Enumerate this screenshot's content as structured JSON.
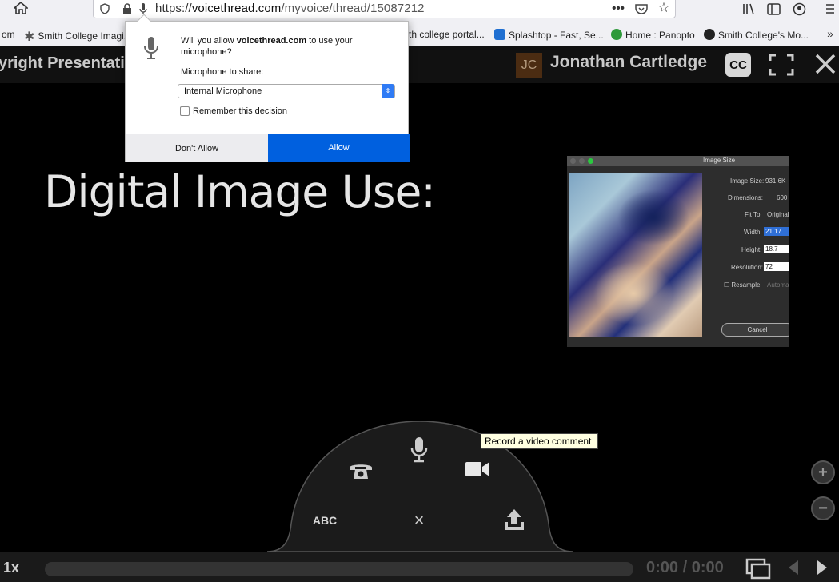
{
  "browser": {
    "url_scheme": "https://",
    "url_host": "voicethread.com",
    "url_path": "/myvoice/thread/15087212",
    "bookmarks": [
      {
        "label": "om",
        "icon": "none"
      },
      {
        "label": "Smith College Imagi...",
        "icon": "asterisk-icon",
        "color": "#555555"
      },
      {
        "label": "th college portal...",
        "icon": "none"
      },
      {
        "label": "Splashtop - Fast, Se...",
        "icon": "splashtop-icon",
        "color": "#1f6fd1"
      },
      {
        "label": "Home : Panopto",
        "icon": "panopto-icon",
        "color": "#2e9a3a"
      },
      {
        "label": "Smith College's Mo...",
        "icon": "moodle-icon",
        "color": "#222222"
      }
    ]
  },
  "permission": {
    "question_prefix": "Will you allow ",
    "question_site": "voicethread.com",
    "question_suffix": " to use your microphone?",
    "share_label": "Microphone to share:",
    "selected_device": "Internal Microphone",
    "remember_label": "Remember this decision",
    "remember_checked": false,
    "deny_label": "Don't Allow",
    "allow_label": "Allow"
  },
  "voicethread": {
    "title": "yright Presentati",
    "user_initials": "JC",
    "user_name": "Jonathan Cartledge",
    "cc_label": "CC",
    "slide_title": "Digital Image Use:"
  },
  "embedded_dialog": {
    "title": "Image Size",
    "rows": [
      {
        "label": "Image Size:",
        "value": "931.6K"
      },
      {
        "label": "Dimensions:",
        "value": "600"
      },
      {
        "label": "Fit To:",
        "value": "Original"
      },
      {
        "label": "Width:",
        "value": "21.17"
      },
      {
        "label": "Height:",
        "value": "18.7"
      },
      {
        "label": "Resolution:",
        "value": "72"
      }
    ],
    "resample_label": "Resample:",
    "resample_value": "Automa",
    "cancel_label": "Cancel"
  },
  "comment_menu": {
    "tooltip": "Record a video comment",
    "text_label": "ABC",
    "close_label": "×",
    "items": [
      "phone-icon",
      "microphone-icon",
      "video-camera-icon",
      "text-comment",
      "close-icon",
      "upload-icon"
    ]
  },
  "playback": {
    "speed": "1x",
    "time": "0:00 / 0:00"
  }
}
